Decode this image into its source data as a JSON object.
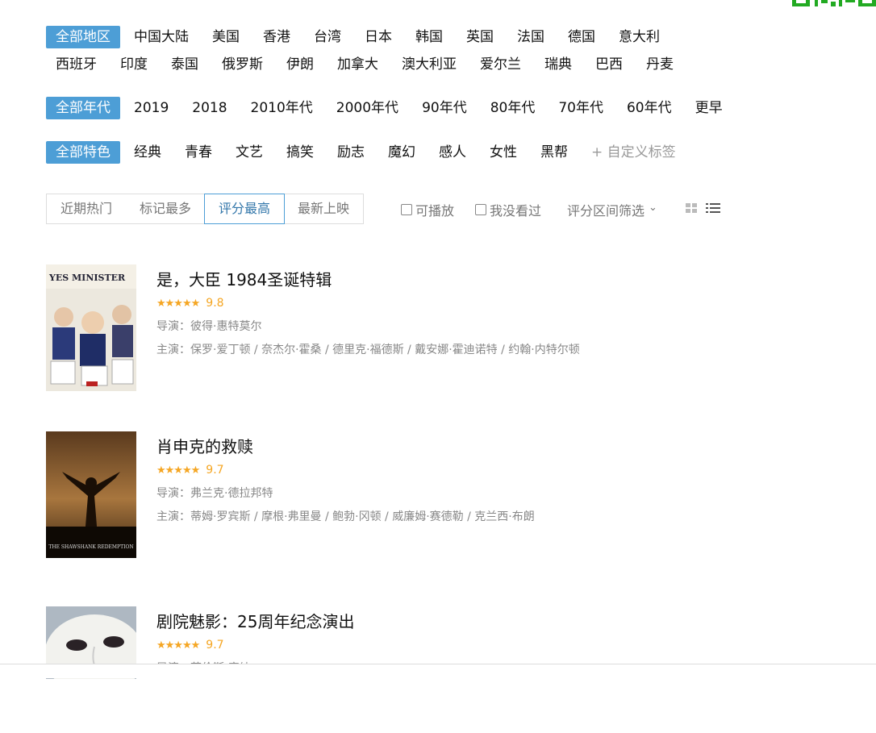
{
  "filters": {
    "regions": [
      "全部地区",
      "中国大陆",
      "美国",
      "香港",
      "台湾",
      "日本",
      "韩国",
      "英国",
      "法国",
      "德国",
      "意大利",
      "西班牙",
      "印度",
      "泰国",
      "俄罗斯",
      "伊朗",
      "加拿大",
      "澳大利亚",
      "爱尔兰",
      "瑞典",
      "巴西",
      "丹麦"
    ],
    "years": [
      "全部年代",
      "2019",
      "2018",
      "2010年代",
      "2000年代",
      "90年代",
      "80年代",
      "70年代",
      "60年代",
      "更早"
    ],
    "features": [
      "全部特色",
      "经典",
      "青春",
      "文艺",
      "搞笑",
      "励志",
      "魔幻",
      "感人",
      "女性",
      "黑帮"
    ],
    "custom_tag": "+ 自定义标签"
  },
  "sort": {
    "tabs": [
      "近期热门",
      "标记最多",
      "评分最高",
      "最新上映"
    ],
    "active": "评分最高",
    "playable": "可播放",
    "not_seen": "我没看过",
    "score_filter": "评分区间筛选",
    "dropdown_glyph": "⌄"
  },
  "items": [
    {
      "title": "是，大臣 1984圣诞特辑",
      "stars": "★★★★★",
      "score": "9.8",
      "director": "导演：彼得·惠特莫尔",
      "cast": "主演：保罗·爱丁顿 / 奈杰尔·霍桑 / 德里克·福德斯 / 戴安娜·霍迪诺特 / 约翰·内特尔顿",
      "poster_text": "YES MINISTER"
    },
    {
      "title": "肖申克的救赎",
      "stars": "★★★★★",
      "score": "9.7",
      "director": "导演：弗兰克·德拉邦特",
      "cast": "主演：蒂姆·罗宾斯 / 摩根·弗里曼 / 鲍勃·冈顿 / 威廉姆·赛德勒 / 克兰西·布朗",
      "poster_text": "THE SHAWSHANK REDEMPTION"
    },
    {
      "title": "剧院魅影：25周年纪念演出",
      "stars": "★★★★★",
      "score": "9.7",
      "director": "导演：劳伦斯·康纳",
      "cast": ""
    }
  ],
  "colors": {
    "accent": "#4d9ed6",
    "star": "#f5a623"
  },
  "icons": [
    "qr-code-icon",
    "grid-view-icon",
    "list-view-icon",
    "chevron-down-icon"
  ]
}
